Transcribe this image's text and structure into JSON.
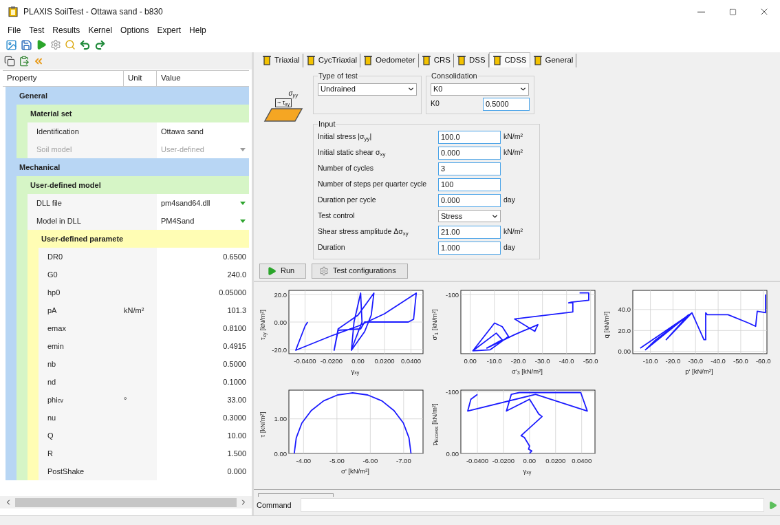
{
  "window": {
    "title": "PLAXIS SoilTest - Ottawa sand - b830"
  },
  "menu": [
    "File",
    "Test",
    "Results",
    "Kernel",
    "Options",
    "Expert",
    "Help"
  ],
  "property_table": {
    "columns": [
      "Property",
      "Unit",
      "Value"
    ],
    "groups": [
      {
        "label": "General",
        "children": [
          {
            "label": "Material set",
            "children": [
              {
                "label": "Identification",
                "value": "Ottawa sand",
                "kind": "text",
                "disabled": false
              },
              {
                "label": "Soil model",
                "value": "User-defined",
                "kind": "dropdown",
                "disabled": true
              }
            ]
          }
        ]
      },
      {
        "label": "Mechanical",
        "children": [
          {
            "label": "User-defined model",
            "children": [
              {
                "label": "DLL file",
                "value": "pm4sand64.dll",
                "kind": "dropdown",
                "disabled": false
              },
              {
                "label": "Model in DLL",
                "value": "PM4Sand",
                "kind": "dropdown",
                "disabled": false
              },
              {
                "label": "User-defined paramete",
                "children": [
                  {
                    "label": "DR0",
                    "value": "0.6500",
                    "kind": "number",
                    "disabled": false
                  },
                  {
                    "label": "G0",
                    "value": "240.0",
                    "kind": "number",
                    "disabled": false
                  },
                  {
                    "label": "hp0",
                    "value": "0.05000",
                    "kind": "number",
                    "disabled": false
                  },
                  {
                    "label": "pA",
                    "unit": "kN/m²",
                    "value": "101.3",
                    "kind": "number",
                    "disabled": false
                  },
                  {
                    "label": "emax",
                    "value": "0.8100",
                    "kind": "number",
                    "disabled": false
                  },
                  {
                    "label": "emin",
                    "value": "0.4915",
                    "kind": "number",
                    "disabled": false
                  },
                  {
                    "label": "nb",
                    "value": "0.5000",
                    "kind": "number",
                    "disabled": false
                  },
                  {
                    "label": "nd",
                    "value": "0.1000",
                    "kind": "number",
                    "disabled": false
                  },
                  {
                    "label": "phi$_{cv}$",
                    "unit": "°",
                    "value": "33.00",
                    "kind": "number",
                    "disabled": false
                  },
                  {
                    "label": "nu",
                    "value": "0.3000",
                    "kind": "number",
                    "disabled": false
                  },
                  {
                    "label": "Q",
                    "value": "10.00",
                    "kind": "number",
                    "disabled": false
                  },
                  {
                    "label": "R",
                    "value": "1.500",
                    "kind": "number",
                    "disabled": false
                  },
                  {
                    "label": "PostShake",
                    "value": "0.000",
                    "kind": "number",
                    "disabled": false
                  }
                ]
              }
            ]
          }
        ]
      }
    ]
  },
  "tabs": [
    {
      "label": "Triaxial",
      "selected": false
    },
    {
      "label": "CycTriaxial",
      "selected": false
    },
    {
      "label": "Oedometer",
      "selected": false
    },
    {
      "label": "CRS",
      "selected": false
    },
    {
      "label": "DSS",
      "selected": false
    },
    {
      "label": "CDSS",
      "selected": true
    },
    {
      "label": "General",
      "selected": false
    }
  ],
  "specimen_labels": [
    "σ$_{yy}$",
    "~ τ$_{xy}$"
  ],
  "type_of_test": {
    "title": "Type of test",
    "value": "Undrained"
  },
  "consolidation": {
    "title": "Consolidation",
    "value": "K0",
    "k0_label": "K0",
    "k0_value": "0.5000"
  },
  "input": {
    "title": "Input",
    "rows": [
      {
        "label": "Initial stress |σ$_{yy}$|",
        "value": "100.0",
        "unit": "kN/m²",
        "kind": "input"
      },
      {
        "label": "Initial static shear σ$_{xy}$",
        "value": "0.000",
        "unit": "kN/m²",
        "kind": "input"
      },
      {
        "label": "Number of cycles",
        "value": "3",
        "kind": "input"
      },
      {
        "label": "Number of steps per quarter cycle",
        "value": "100",
        "kind": "input"
      },
      {
        "label": "Duration per cycle",
        "value": "0.000",
        "unit": "day",
        "kind": "input"
      },
      {
        "label": "Test control",
        "value": "Stress",
        "kind": "select"
      },
      {
        "label": "Shear stress amplitude Δσ$_{xy}$",
        "value": "21.00",
        "unit": "kN/m²",
        "kind": "input"
      },
      {
        "label": "Duration",
        "value": "1.000",
        "unit": "day",
        "kind": "input"
      }
    ]
  },
  "buttons": [
    {
      "label": "Run",
      "kind": "run"
    },
    {
      "label": "Test configurations",
      "kind": "config"
    }
  ],
  "charts": [
    {
      "chart_data": {
        "type": "line",
        "grid": true,
        "xlabel": "γ$_{xy}$",
        "ylabel": "τ$_{xy}$ [kN/m²]",
        "xlim": [
          -0.0522,
          0.0491
        ],
        "ylim": [
          -23,
          23
        ],
        "xticks": [
          {
            "value": -0.04,
            "label": "-0.0400"
          },
          {
            "value": -0.02,
            "label": "-0.0200"
          },
          {
            "value": 0,
            "label": "0.00"
          },
          {
            "value": 0.02,
            "label": "0.0200"
          },
          {
            "value": 0.04,
            "label": "0.0400"
          }
        ],
        "yticks": [
          {
            "value": 20,
            "label": "20.0"
          },
          {
            "value": 0,
            "label": "0.00"
          },
          {
            "value": -20,
            "label": "-20.0"
          }
        ],
        "x": [
          -0.038,
          -0.04,
          -0.046,
          -0.047,
          -0.02,
          0,
          0.02,
          0.044,
          0.042,
          0.038,
          0.005,
          0.002,
          -0.015,
          -0.018,
          -0.015,
          0,
          0.012,
          0.01,
          0.005,
          -0.005,
          -0.003,
          0.002,
          0.003,
          -0.005
        ],
        "series": [
          {
            "color": "#1a1aff",
            "values": [
              0,
              -3,
              -18,
              -20.5,
              -10,
              -3,
              6,
              21,
              2,
              0,
              0,
              -5,
              -6,
              -20.5,
              -5,
              5,
              21,
              5,
              -7,
              -20.5,
              0,
              21,
              0,
              -20
            ]
          }
        ]
      }
    },
    {
      "kind": "picture",
      "xlabel": "σ'$_{3}$ [kN/m²]",
      "ylabel": "σ'$_{1}$ [kN/m²]",
      "x_tick_labels": [
        "0.00",
        "-10.0",
        "-20.0",
        "-30.0",
        "-40.0",
        "-50.0"
      ],
      "y_tick_labels": [
        "-100"
      ]
    },
    {
      "chart_data": {
        "type": "line",
        "grid": true,
        "xlabel": "p' [kN/m²]",
        "ylabel": "q [kN/m²]",
        "xlim": [
          -2.2,
          -61.6
        ],
        "ylim": [
          -2.1,
          58.3
        ],
        "xticks": [
          {
            "value": -10,
            "label": "-10.0"
          },
          {
            "value": -20,
            "label": "-20.0"
          },
          {
            "value": -30,
            "label": "-30.0"
          },
          {
            "value": -40,
            "label": "-40.0"
          },
          {
            "value": -50,
            "label": "-50.0"
          },
          {
            "value": -60,
            "label": "-60.0"
          }
        ],
        "yticks": [
          {
            "value": 0,
            "label": "0.00"
          },
          {
            "value": 20,
            "label": "20.0"
          },
          {
            "value": 40,
            "label": "40.0"
          }
        ],
        "x": [
          -5.5,
          -28.4,
          -12.4,
          -7.8,
          -26.9,
          -17,
          -28.4,
          -33.7,
          -34.5,
          -34.5,
          -35.2,
          -44.4,
          -53.5,
          -56.6,
          -57.3,
          -61,
          -61
        ],
        "series": [
          {
            "color": "#1a1aff",
            "values": [
              3.2,
              36.8,
              11.2,
              1.6,
              35,
              11.2,
              36.8,
              11.2,
              11.2,
              36.8,
              35.1,
              35.1,
              27.1,
              24,
              38.4,
              37,
              54.4
            ]
          }
        ]
      }
    },
    {
      "chart_data": {
        "type": "line",
        "grid": true,
        "xlabel": "σ' [kN/m²]",
        "ylabel": "τ [kN/m²]",
        "xlim": [
          -3.56,
          -7.58
        ],
        "ylim": [
          0,
          1.83
        ],
        "xticks": [
          {
            "value": -4,
            "label": "-4.00"
          },
          {
            "value": -5,
            "label": "-5.00"
          },
          {
            "value": -6,
            "label": "-6.00"
          },
          {
            "value": -7,
            "label": "-7.00"
          }
        ],
        "yticks": [
          {
            "value": 0,
            "label": "0.00"
          },
          {
            "value": 1,
            "label": "1.00"
          }
        ],
        "x": [
          -3.72,
          -3.78,
          -3.95,
          -4.23,
          -4.6,
          -5.02,
          -5.47,
          -5.92,
          -6.35,
          -6.71,
          -6.99,
          -7.16,
          -7.22
        ],
        "series": [
          {
            "color": "#1a1aff",
            "values": [
              0,
              0.45,
              0.88,
              1.24,
              1.52,
              1.69,
              1.75,
              1.69,
              1.52,
              1.24,
              0.88,
              0.45,
              0
            ]
          }
        ]
      }
    },
    {
      "chart_data": {
        "type": "line",
        "grid": true,
        "xlabel": "γ$_{xy}$",
        "ylabel": "p$_{Excess}$ [kN/m²]",
        "xlim": [
          -0.0527,
          0.0502
        ],
        "ylim": [
          0,
          -102.9
        ],
        "xticks": [
          {
            "value": -0.04,
            "label": "-0.0400"
          },
          {
            "value": -0.02,
            "label": "-0.0200"
          },
          {
            "value": 0,
            "label": "0.00"
          },
          {
            "value": 0.02,
            "label": "0.0200"
          },
          {
            "value": 0.04,
            "label": "0.0400"
          }
        ],
        "yticks": [
          {
            "value": 0,
            "label": "0.00"
          },
          {
            "value": -100,
            "label": "-100"
          }
        ],
        "x": [
          0,
          0.0017,
          -0.0008,
          0,
          -0.004,
          -0.0065,
          0.0096,
          0.0071,
          0,
          -0.0177,
          -0.014,
          -0.0078,
          0.0393,
          0.0443,
          0.0046,
          -0.0474,
          -0.045,
          -0.04
        ],
        "series": [
          {
            "color": "#1a1aff",
            "values": [
              0,
              -4,
              -7,
              -12,
              -26,
              -29,
              -60,
              -64,
              -88,
              -69,
              -96,
              -99,
              -99,
              -69,
              -96,
              -69,
              -88,
              -96
            ]
          }
        ]
      }
    }
  ],
  "command": {
    "label": "Command"
  }
}
